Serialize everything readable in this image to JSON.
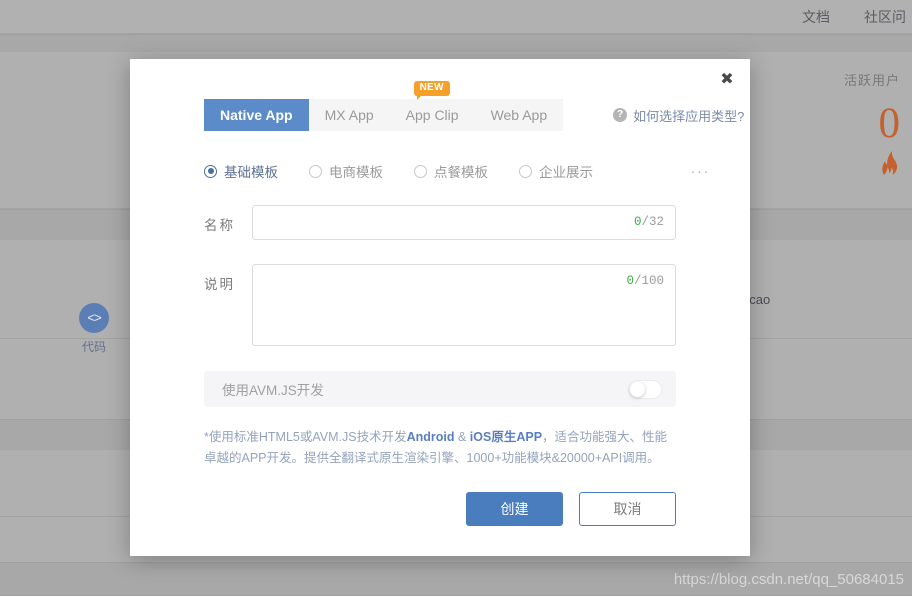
{
  "background": {
    "topbar_links": [
      "文档",
      "社区问"
    ],
    "code_chip": {
      "icon": "code-brackets-icon",
      "glyph": "<>",
      "label": "代码"
    },
    "active_users": {
      "title": "活跃用户",
      "value": "0",
      "icon": "flame-icon",
      "glyph": "🔥"
    },
    "username_fragment": "ncao",
    "watermark": "https://blog.csdn.net/qq_50684015",
    "accent_orange": "#c4622f",
    "overlay_color": "#ababab"
  },
  "modal": {
    "close_icon": "close-icon",
    "close_glyph": "✖",
    "tabs": [
      {
        "label": "Native App",
        "active": true,
        "badge": null
      },
      {
        "label": "MX App",
        "active": false,
        "badge": null
      },
      {
        "label": "App Clip",
        "active": false,
        "badge": "NEW"
      },
      {
        "label": "Web App",
        "active": false,
        "badge": null
      }
    ],
    "help": {
      "icon": "question-mark-icon",
      "glyph": "?",
      "label": "如何选择应用类型?"
    },
    "templates": [
      {
        "label": "基础模板",
        "selected": true
      },
      {
        "label": "电商模板",
        "selected": false
      },
      {
        "label": "点餐模板",
        "selected": false
      },
      {
        "label": "企业展示",
        "selected": false
      }
    ],
    "more_icon": "more-horizontal-icon",
    "more_glyph": "···",
    "fields": {
      "name": {
        "label": "名称",
        "value": "",
        "placeholder": "",
        "count": "0",
        "limit": "/32"
      },
      "description": {
        "label": "说明",
        "value": "",
        "placeholder": "",
        "count": "0",
        "limit": "/100"
      }
    },
    "avm": {
      "label": "使用AVM.JS开发",
      "enabled": false
    },
    "footnote": {
      "part1": "*使用标准HTML5或AVM.JS技术开发",
      "highlight1": "Android",
      "part2": " & ",
      "highlight2": "iOS原生APP",
      "part3": "，适合功能强大、性能卓越的APP开发。提供全翻译式原生渲染引擎、1000+功能模块&20000+API调用。"
    },
    "buttons": {
      "primary": "创建",
      "secondary": "取消"
    },
    "accent_blue": "#4a7dbd",
    "badge_orange": "#f5a02a"
  }
}
